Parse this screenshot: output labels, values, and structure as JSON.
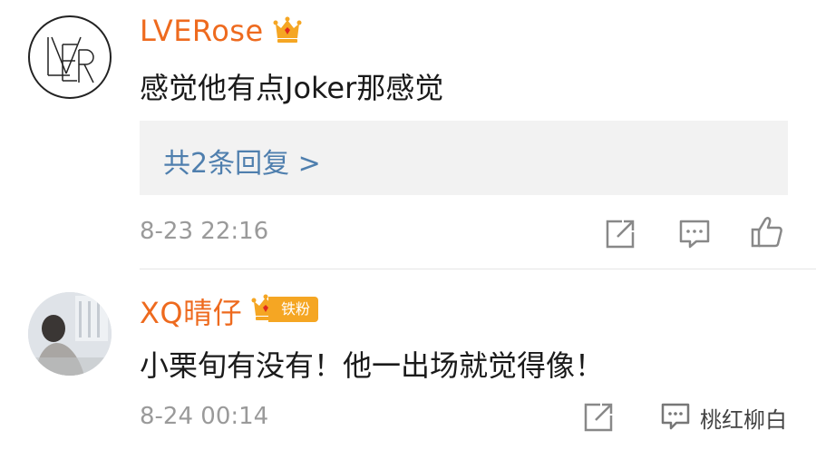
{
  "comments": [
    {
      "username": "LVERose",
      "text": "感觉他有点Joker那感觉",
      "reply_link": "共2条回复 >",
      "time": "8-23 22:16",
      "avatar_letters": "LVER"
    },
    {
      "username": "XQ晴仔",
      "badge": "铁粉",
      "text": "小栗旬有没有！他一出场就觉得像！",
      "time": "8-24 00:14"
    }
  ],
  "watermark": "桃红柳白",
  "colors": {
    "username": "#ee6a1e",
    "link": "#4f7fae",
    "crown": "#f5a623",
    "time": "#9a9a9a"
  },
  "icons": [
    "crown-icon",
    "share-icon",
    "comment-icon",
    "like-icon"
  ]
}
